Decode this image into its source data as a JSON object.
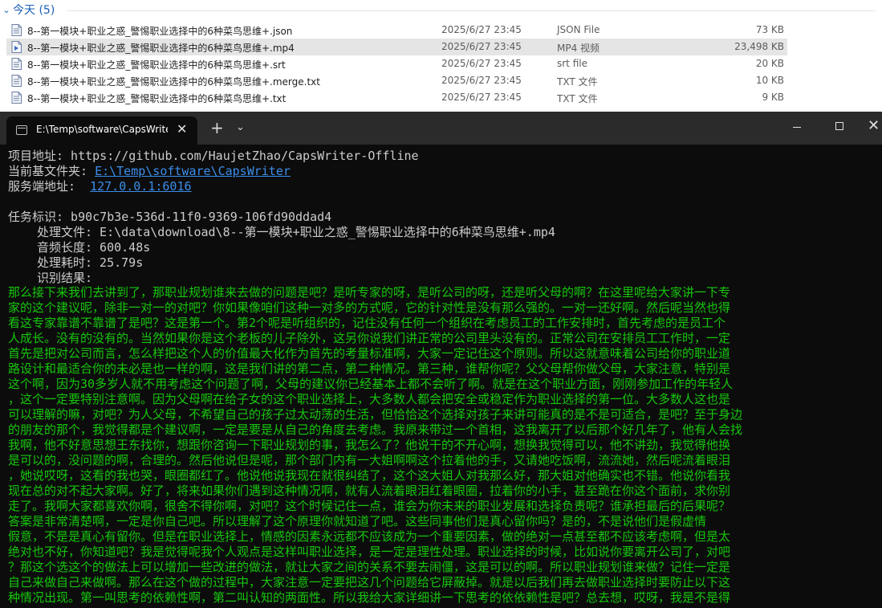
{
  "explorer": {
    "group": {
      "label": "今天 (5)"
    },
    "files": [
      {
        "name": "8--第一模块+职业之惑_警惕职业选择中的6种菜鸟思维+.json",
        "date": "2025/6/27 23:45",
        "type": "JSON File",
        "size": "73 KB",
        "icon": "json-file-icon"
      },
      {
        "name": "8--第一模块+职业之惑_警惕职业选择中的6种菜鸟思维+.mp4",
        "date": "2025/6/27 23:45",
        "type": "MP4 视频",
        "size": "23,498 KB",
        "icon": "video-file-icon"
      },
      {
        "name": "8--第一模块+职业之惑_警惕职业选择中的6种菜鸟思维+.srt",
        "date": "2025/6/27 23:45",
        "type": "srt file",
        "size": "20 KB",
        "icon": "text-file-icon"
      },
      {
        "name": "8--第一模块+职业之惑_警惕职业选择中的6种菜鸟思维+.merge.txt",
        "date": "2025/6/27 23:45",
        "type": "TXT 文件",
        "size": "10 KB",
        "icon": "text-file-icon"
      },
      {
        "name": "8--第一模块+职业之惑_警惕职业选择中的6种菜鸟思维+.txt",
        "date": "2025/6/27 23:45",
        "type": "TXT 文件",
        "size": "9 KB",
        "icon": "text-file-icon"
      }
    ],
    "selected_index": 1
  },
  "terminal": {
    "tab_title": "E:\\Temp\\software\\CapsWriter\\",
    "icons": {
      "tab": "terminal-icon",
      "close_tab": "close-icon",
      "new_tab": "plus-icon",
      "dropdown": "chevron-down-icon"
    },
    "window_controls": {
      "minimize": "minimize-icon",
      "maximize": "maximize-icon",
      "close": "close-icon"
    },
    "header": {
      "project_line": "项目地址: https://github.com/HaujetZhao/CapsWriter-Offline",
      "base_folder_label": "当前基文件夹: ",
      "base_folder_value": "E:\\Temp\\software\\CapsWriter",
      "server_label": "服务端地址:  ",
      "server_value": "127.0.0.1:6016"
    },
    "task": {
      "id_line": "任务标识: b90c7b3e-536d-11f0-9369-106fd90ddad4",
      "file_line": "处理文件: E:\\data\\download\\8--第一模块+职业之惑_警惕职业选择中的6种菜鸟思维+.mp4",
      "duration_line": "音频长度: 600.48s",
      "elapsed_line": "处理耗时: 25.79s",
      "result_label": "识别结果:"
    },
    "result_lines": [
      "那么接下来我们去讲到了，那职业规划谁来去做的问题是吧？是听专家的呀，是听公司的呀，还是听父母的啊？在这里呢给大家讲一下专",
      "家的这个建议呢，除非一对一的对吧？你如果像咱们这种一对多的方式呢，它的针对性是没有那么强的。一对一还好啊。然后呢当然也得",
      "看这专家靠谱不靠谱了是吧？这是第一个。第2个呢是听组织的，记住没有任何一个组织在考虑员工的工作安排时，首先考虑的是员工个",
      "人成长。没有的没有的。当然如果你是这个老板的儿子除外，这另你说我们讲正常的公司里头没有的。正常公司在安排员工工作时，一定",
      "首先是把对公司而言，怎么样把这个人的价值最大化作为首先的考量标准啊，大家一定记住这个原则。所以这就意味着公司给你的职业道",
      "路设计和最适合你的未必是也一样的啊，这是我们讲的第二点，第二种情况。第三种，谁帮你呢？父父母帮你做父母，大家注意，特别是",
      "这个啊，因为30多岁人就不用考虑这个问题了啊，父母的建议你已经基本上都不会听了啊。就是在这个职业方面，刚刚参加工作的年轻人",
      "，这个一定要特别注意啊。因为父母啊在给子女的这个职业选择上，大多数人都会把安全或稳定作为职业选择的第一位。大多数人这也是",
      "可以理解的嘛，对吧？为人父母，不希望自己的孩子过太动荡的生活，但恰恰这个选择对孩子来讲可能真的是不是可适合，是吧？至于身边",
      "的朋友的那个，我觉得都是个建议啊，一定是要是从自己的角度去考虑。我原来带过一个首相，这我离开了以后那个好几年了，他有人会找",
      "我啊，他不好意思想王东找你，想跟你咨询一下职业规划的事，我怎么了？他说干的不开心啊，想换我觉得可以，他不讲劲，我觉得他换",
      "是可以的，没问题的啊，合理的。然后他说但是呢，那个部门内有一大姐啊啊这个拉着他的手，又请她吃饭啊，流流她，然后呢流着眼泪",
      "，她说哎呀，这看的我也哭，眼圈都红了。他说他说我现在就很纠结了，这个这大姐人对我那么好，那大姐对他确实也不错。他说你看我",
      "现在总的对不起大家啊。好了，将来如果你们遇到这种情况啊，就有人流着眼泪红着眼圈，拉着你的小手，甚至跪在你这个面前，求你别",
      "走了。我啊大家都喜欢你啊，很舍不得你啊，对吧？这个时候记住一点，谁会为你未来的职业发展和选择负责呢？谁承担最后的后果呢？",
      "答案是非常清楚啊，一定是你自己吧。所以理解了这个原理你就知道了吧。这些同事他们是真心留你吗？是的，不是说他们是假虚情",
      "假意，不是是真心有留你。但是在职业选择上，情感的因素永远都不应该成为一个重要因素，做的绝对一点甚至都不应该考虑啊，但是太",
      "绝对也不好，你知道吧？我是觉得呢我个人观点是这样叫职业选择，是一定是理性处理。职业选择的时候，比如说你要离开公司了，对吧",
      "？那这个选这个的做法上可以增加一些改进的做法，就让大家之间的关系不要去闹僵，这是可以的啊。所以职业规划谁来做？记住一定是",
      "自己来做自己来做啊。那么在这个做的过程中，大家注意一定要把这几个问题给它屏蔽掉。就是以后我们再去做职业选择时要防止以下这",
      "种情况出现。第一叫思考的依赖性啊，第二叫认知的两面性。所以我给大家详细讲一下思考的依依赖性是吧？总去想，哎呀，我是不是得"
    ]
  }
}
